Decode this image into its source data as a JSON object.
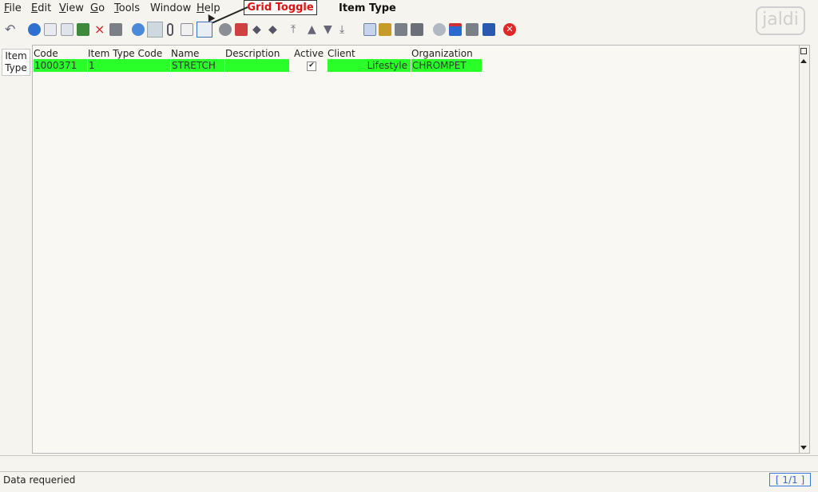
{
  "menu": {
    "items": [
      {
        "label": "File",
        "ul": "F",
        "rest": "ile"
      },
      {
        "label": "Edit",
        "ul": "E",
        "rest": "dit"
      },
      {
        "label": "View",
        "ul": "V",
        "rest": "iew"
      },
      {
        "label": "Go",
        "ul": "G",
        "rest": "o"
      },
      {
        "label": "Tools",
        "ul": "T",
        "rest": "ools"
      },
      {
        "label": "Window",
        "ul": "",
        "rest": "Window"
      },
      {
        "label": "Help",
        "ul": "H",
        "rest": "elp"
      }
    ]
  },
  "annotation": {
    "label": "Grid Toggle"
  },
  "window": {
    "title": "Item Type"
  },
  "logo": {
    "text": "jaldi"
  },
  "tab": {
    "label": "Item Type"
  },
  "grid": {
    "columns": [
      "Code",
      "Item Type Code",
      "Name",
      "Description",
      "Active",
      "Client",
      "Organization"
    ],
    "rows": [
      {
        "code": "1000371",
        "item_type_code": "1",
        "name": "STRETCH",
        "description": "",
        "active": "✔",
        "client": "Lifestyle",
        "organization": "CHROMPET"
      }
    ]
  },
  "status": {
    "message": "Data requeried",
    "record_count": "[ 1/1 ]"
  },
  "colors": {
    "row_highlight": "#2aff2a",
    "annotation_text": "#e01010"
  }
}
